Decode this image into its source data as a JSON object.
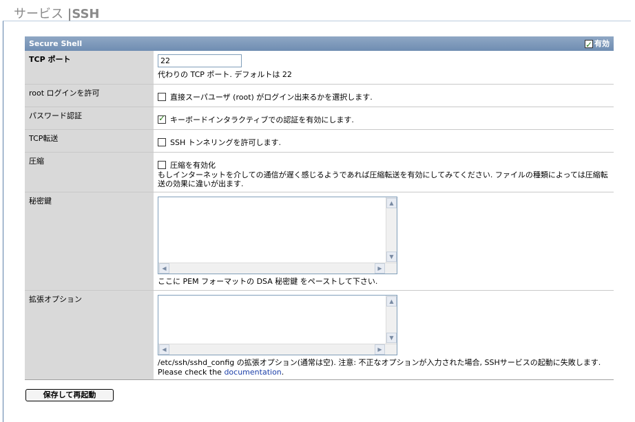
{
  "page": {
    "title_main": "サービス",
    "title_sep": "|",
    "title_sub": "SSH"
  },
  "box": {
    "title": "Secure Shell",
    "enable_label": "有効",
    "enabled": true
  },
  "rows": {
    "tcp": {
      "label": "TCP ポート",
      "value": "22",
      "hint": "代わりの TCP ポート. デフォルトは 22"
    },
    "root": {
      "label": "root ログインを許可",
      "checkbox_label": "直接スーパユーザ (root) がログイン出来るかを選択します.",
      "checked": false
    },
    "password": {
      "label": "パスワード認証",
      "checkbox_label": "キーボードインタラクティブでの認証を有効にします.",
      "checked": true
    },
    "forwarding": {
      "label": "TCP転送",
      "checkbox_label": "SSH トンネリングを許可します.",
      "checked": false
    },
    "compression": {
      "label": "圧縮",
      "checkbox_label": "圧縮を有効化",
      "checked": false,
      "description": "もしインターネットを介しての通信が遅く感じるようであれば圧縮転送を有効にしてみてください. ファイルの種類によっては圧縮転送の効果に違いが出ます."
    },
    "private_key": {
      "label": "秘密鍵",
      "value": "",
      "hint": "ここに PEM フォーマットの DSA 秘密鍵 をペーストして下さい."
    },
    "extended": {
      "label": "拡張オプション",
      "value": "",
      "hint": "/etc/ssh/sshd_config の拡張オプション(通常は空). 注意: 不正なオプションが入力された場合, SSHサービスの起動に失敗します.",
      "check_prefix": "Please check the",
      "link_text": "documentation",
      "check_suffix": "."
    }
  },
  "actions": {
    "save_label": "保存して再起動"
  }
}
